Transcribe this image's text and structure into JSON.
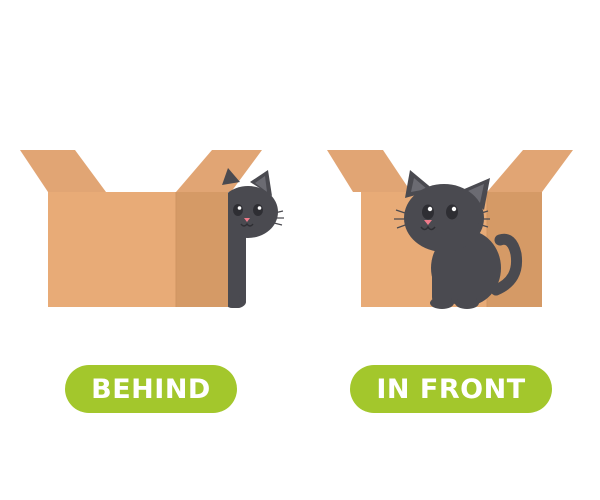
{
  "labels": {
    "behind": "BEHIND",
    "in_front": "IN FRONT"
  },
  "colors": {
    "pill_green": "#a3c72c",
    "box_front": "#e8ab77",
    "box_side": "#d59a66",
    "box_flap": "#e1a574",
    "box_flap_dark": "#cf9461",
    "box_inside": "#c8884f",
    "cat_fur": "#4a4a50",
    "cat_fur_light": "#5c5c63",
    "cat_ear_inner": "#6b6b72",
    "cat_eye_white": "#ffffff",
    "cat_nose": "#f07a8a"
  },
  "illustrations": {
    "left": "cat-peeking-behind-box",
    "right": "cat-sitting-in-front-of-box"
  }
}
